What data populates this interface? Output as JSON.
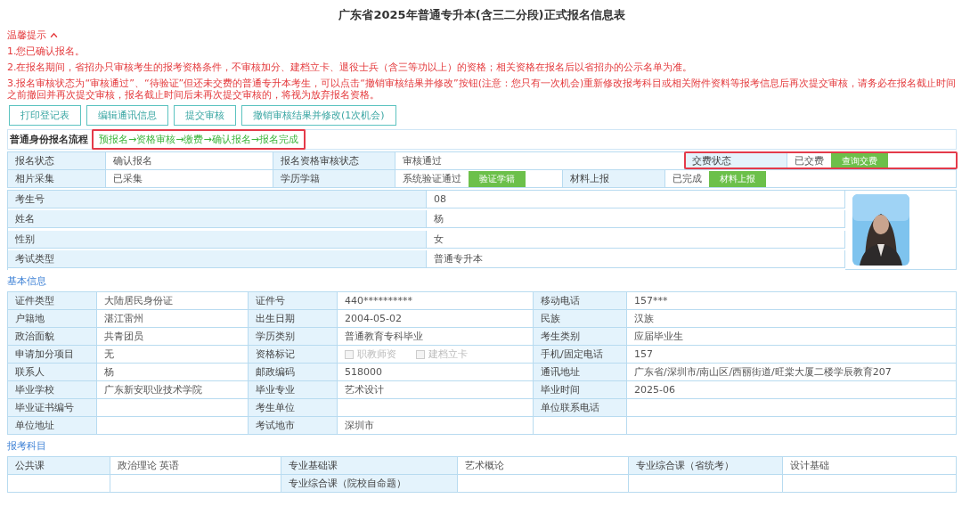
{
  "title": "广东省2025年普通专升本(含三二分段)正式报名信息表",
  "notice": {
    "heading": "温馨提示",
    "expanded": true,
    "items": [
      "1.您已确认报名。",
      "2.在报名期间，省招办只审核考生的报考资格条件，不审核加分、建档立卡、退役士兵（含三等功以上）的资格；相关资格在报名后以省招办的公示名单为准。",
      "3.报名审核状态为“审核通过”、“待验证”但还未交费的普通专升本考生，可以点击“撤销审核结果并修改”按钮(注意：您只有一次机会)重新修改报考科目或相关附件资料等报考信息后再次提交审核，请务必在报名截止时间之前撤回并再次提交审核，报名截止时间后未再次提交审核的，将视为放弃报名资格。"
    ]
  },
  "actions": [
    "打印登记表",
    "编辑通讯信息",
    "提交审核",
    "撤销审核结果并修改(1次机会)"
  ],
  "flow": {
    "label": "普通身份报名流程",
    "steps": "预报名→资格审核→缴费→确认报名→报名完成",
    "highlighted": true
  },
  "status": {
    "rows": [
      [
        {
          "label": "报名状态",
          "value": "确认报名"
        },
        {
          "label": "报名资格审核状态",
          "value": "审核通过"
        },
        {
          "label": "交费状态",
          "value": "已交费",
          "button": "查询交费",
          "highlighted": true
        }
      ],
      [
        {
          "label": "相片采集",
          "value": "已采集"
        },
        {
          "label": "学历学籍",
          "value": "系统验证通过",
          "button": "验证学籍"
        },
        {
          "label": "材料上报",
          "value": "已完成",
          "button": "材料上报"
        }
      ]
    ]
  },
  "candidate": [
    {
      "label": "考生号",
      "value": "08"
    },
    {
      "label": "姓名",
      "value": "杨"
    },
    {
      "label": "性别",
      "value": "女"
    },
    {
      "label": "考试类型",
      "value": "普通专升本"
    }
  ],
  "basic": {
    "heading": "基本信息",
    "rows": [
      [
        {
          "label": "证件类型",
          "value": "大陆居民身份证"
        },
        {
          "label": "证件号",
          "value": "440**********"
        },
        {
          "label": "移动电话",
          "value": "157***"
        }
      ],
      [
        {
          "label": "户籍地",
          "value": "湛江雷州"
        },
        {
          "label": "出生日期",
          "value": "2004-05-02"
        },
        {
          "label": "民族",
          "value": "汉族"
        }
      ],
      [
        {
          "label": "政治面貌",
          "value": "共青团员"
        },
        {
          "label": "学历类别",
          "value": "普通教育专科毕业"
        },
        {
          "label": "考生类别",
          "value": "应届毕业生"
        }
      ],
      [
        {
          "label": "申请加分项目",
          "value": "无"
        },
        {
          "label": "资格标记",
          "checks": [
            {
              "label": "职教师资",
              "checked": false,
              "disabled": true
            },
            {
              "label": "建档立卡",
              "checked": false,
              "disabled": true
            }
          ]
        },
        {
          "label": "手机/固定电话",
          "value": "157"
        }
      ],
      [
        {
          "label": "联系人",
          "value": "杨"
        },
        {
          "label": "邮政编码",
          "value": "518000"
        },
        {
          "label": "通讯地址",
          "value": "广东省/深圳市/南山区/西丽街道/旺棠大厦二楼学辰教育207"
        }
      ],
      [
        {
          "label": "毕业学校",
          "value": "广东新安职业技术学院"
        },
        {
          "label": "毕业专业",
          "value": "艺术设计"
        },
        {
          "label": "毕业时间",
          "value": "2025-06"
        }
      ],
      [
        {
          "label": "毕业证书编号"
        },
        {
          "label": "考生单位"
        },
        {
          "label": "单位联系电话"
        }
      ],
      [
        {
          "label": "单位地址"
        },
        {
          "label": "考试地市",
          "value": "深圳市"
        },
        null
      ]
    ]
  },
  "subjects": {
    "heading": "报考科目",
    "rows": [
      [
        {
          "label": "公共课",
          "value": "政治理论 英语"
        },
        {
          "label": "专业基础课",
          "value": "艺术概论"
        },
        {
          "label": "专业综合课（省统考）",
          "value": "设计基础"
        }
      ],
      [
        null,
        {
          "label": "专业综合课（院校自命题）"
        },
        null
      ]
    ]
  }
}
